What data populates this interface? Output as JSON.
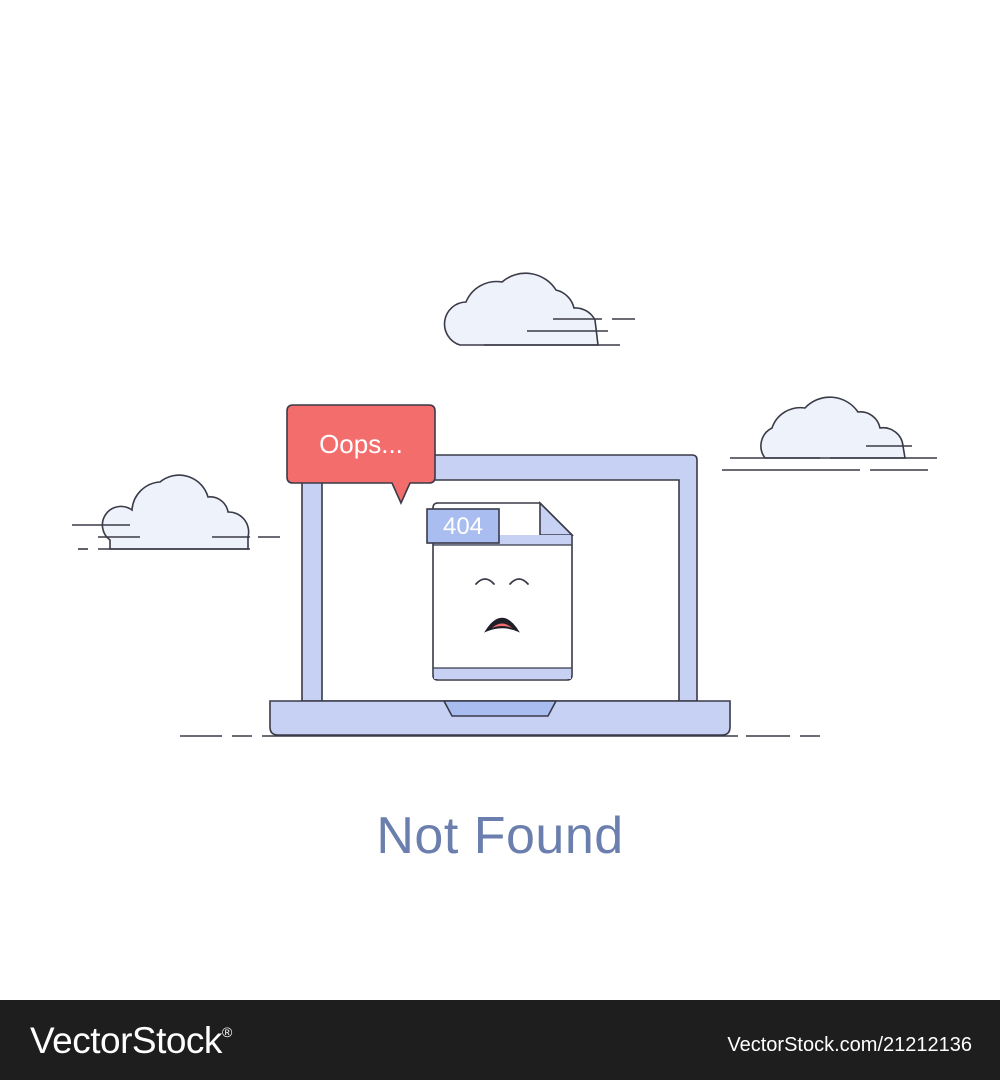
{
  "bubble": {
    "text": "Oops..."
  },
  "file_badge": {
    "text": "404"
  },
  "message": {
    "title": "Not Found"
  },
  "footer": {
    "brand": "VectorStock",
    "registered_mark": "®",
    "image_id": "VectorStock.com/21212136"
  },
  "colors": {
    "outline": "#3a3a48",
    "cloud_fill": "#eef2fb",
    "laptop_fill": "#c7d1f3",
    "bubble_fill": "#f46d6d",
    "badge_fill": "#a9bdf0",
    "title_text": "#6b7fae",
    "footer_bg": "#1e1e1e"
  }
}
